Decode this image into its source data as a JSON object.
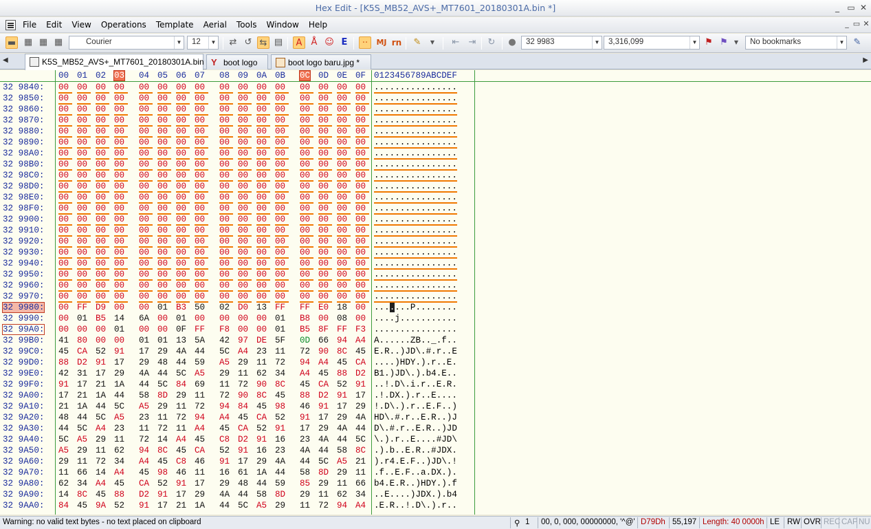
{
  "window": {
    "title": "Hex Edit - [K5S_MB52_AVS+_MT7601_20180301A.bin *]",
    "controls": [
      "_",
      "▭",
      "✕"
    ],
    "mdi_controls": [
      "_",
      "▭",
      "✕"
    ]
  },
  "menu": [
    "File",
    "Edit",
    "View",
    "Operations",
    "Template",
    "Aerial",
    "Tools",
    "Window",
    "Help"
  ],
  "toolbar": {
    "font_name": "Courier",
    "font_size": "12",
    "mj_label": "MJ",
    "rn_label": "rn",
    "e_label": "E",
    "address_combo": "32 9983",
    "value_combo": "3,316,099",
    "bookmarks_combo": "No bookmarks"
  },
  "tabs": [
    {
      "label": "K5S_MB52_AVS+_MT7601_20180301A.bin *",
      "icon": "file-icon",
      "active": true
    },
    {
      "label": "boot logo",
      "icon": "compare-icon",
      "active": false
    },
    {
      "label": "boot logo baru.jpg *",
      "icon": "image-file-icon",
      "active": false
    }
  ],
  "hex": {
    "columns": [
      "00",
      "01",
      "02",
      "03",
      "04",
      "05",
      "06",
      "07",
      "08",
      "09",
      "0A",
      "0B",
      "0C",
      "0D",
      "0E",
      "0F"
    ],
    "char_header": "0123456789ABCDEF",
    "highlight_columns": [
      "03",
      "0C"
    ],
    "rows": [
      {
        "addr": "32 9840:",
        "bytes": [
          "00",
          "00",
          "00",
          "00",
          "00",
          "00",
          "00",
          "00",
          "00",
          "00",
          "00",
          "00",
          "00",
          "00",
          "00",
          "00"
        ],
        "chars": "................"
      },
      {
        "addr": "32 9850:",
        "bytes": [
          "00",
          "00",
          "00",
          "00",
          "00",
          "00",
          "00",
          "00",
          "00",
          "00",
          "00",
          "00",
          "00",
          "00",
          "00",
          "00"
        ],
        "chars": "................"
      },
      {
        "addr": "32 9860:",
        "bytes": [
          "00",
          "00",
          "00",
          "00",
          "00",
          "00",
          "00",
          "00",
          "00",
          "00",
          "00",
          "00",
          "00",
          "00",
          "00",
          "00"
        ],
        "chars": "................"
      },
      {
        "addr": "32 9870:",
        "bytes": [
          "00",
          "00",
          "00",
          "00",
          "00",
          "00",
          "00",
          "00",
          "00",
          "00",
          "00",
          "00",
          "00",
          "00",
          "00",
          "00"
        ],
        "chars": "................"
      },
      {
        "addr": "32 9880:",
        "bytes": [
          "00",
          "00",
          "00",
          "00",
          "00",
          "00",
          "00",
          "00",
          "00",
          "00",
          "00",
          "00",
          "00",
          "00",
          "00",
          "00"
        ],
        "chars": "................"
      },
      {
        "addr": "32 9890:",
        "bytes": [
          "00",
          "00",
          "00",
          "00",
          "00",
          "00",
          "00",
          "00",
          "00",
          "00",
          "00",
          "00",
          "00",
          "00",
          "00",
          "00"
        ],
        "chars": "................"
      },
      {
        "addr": "32 98A0:",
        "bytes": [
          "00",
          "00",
          "00",
          "00",
          "00",
          "00",
          "00",
          "00",
          "00",
          "00",
          "00",
          "00",
          "00",
          "00",
          "00",
          "00"
        ],
        "chars": "................"
      },
      {
        "addr": "32 98B0:",
        "bytes": [
          "00",
          "00",
          "00",
          "00",
          "00",
          "00",
          "00",
          "00",
          "00",
          "00",
          "00",
          "00",
          "00",
          "00",
          "00",
          "00"
        ],
        "chars": "................"
      },
      {
        "addr": "32 98C0:",
        "bytes": [
          "00",
          "00",
          "00",
          "00",
          "00",
          "00",
          "00",
          "00",
          "00",
          "00",
          "00",
          "00",
          "00",
          "00",
          "00",
          "00"
        ],
        "chars": "................"
      },
      {
        "addr": "32 98D0:",
        "bytes": [
          "00",
          "00",
          "00",
          "00",
          "00",
          "00",
          "00",
          "00",
          "00",
          "00",
          "00",
          "00",
          "00",
          "00",
          "00",
          "00"
        ],
        "chars": "................"
      },
      {
        "addr": "32 98E0:",
        "bytes": [
          "00",
          "00",
          "00",
          "00",
          "00",
          "00",
          "00",
          "00",
          "00",
          "00",
          "00",
          "00",
          "00",
          "00",
          "00",
          "00"
        ],
        "chars": "................"
      },
      {
        "addr": "32 98F0:",
        "bytes": [
          "00",
          "00",
          "00",
          "00",
          "00",
          "00",
          "00",
          "00",
          "00",
          "00",
          "00",
          "00",
          "00",
          "00",
          "00",
          "00"
        ],
        "chars": "................"
      },
      {
        "addr": "32 9900:",
        "bytes": [
          "00",
          "00",
          "00",
          "00",
          "00",
          "00",
          "00",
          "00",
          "00",
          "00",
          "00",
          "00",
          "00",
          "00",
          "00",
          "00"
        ],
        "chars": "................"
      },
      {
        "addr": "32 9910:",
        "bytes": [
          "00",
          "00",
          "00",
          "00",
          "00",
          "00",
          "00",
          "00",
          "00",
          "00",
          "00",
          "00",
          "00",
          "00",
          "00",
          "00"
        ],
        "chars": "................"
      },
      {
        "addr": "32 9920:",
        "bytes": [
          "00",
          "00",
          "00",
          "00",
          "00",
          "00",
          "00",
          "00",
          "00",
          "00",
          "00",
          "00",
          "00",
          "00",
          "00",
          "00"
        ],
        "chars": "................"
      },
      {
        "addr": "32 9930:",
        "bytes": [
          "00",
          "00",
          "00",
          "00",
          "00",
          "00",
          "00",
          "00",
          "00",
          "00",
          "00",
          "00",
          "00",
          "00",
          "00",
          "00"
        ],
        "chars": "................"
      },
      {
        "addr": "32 9940:",
        "bytes": [
          "00",
          "00",
          "00",
          "00",
          "00",
          "00",
          "00",
          "00",
          "00",
          "00",
          "00",
          "00",
          "00",
          "00",
          "00",
          "00"
        ],
        "chars": "................"
      },
      {
        "addr": "32 9950:",
        "bytes": [
          "00",
          "00",
          "00",
          "00",
          "00",
          "00",
          "00",
          "00",
          "00",
          "00",
          "00",
          "00",
          "00",
          "00",
          "00",
          "00"
        ],
        "chars": "................"
      },
      {
        "addr": "32 9960:",
        "bytes": [
          "00",
          "00",
          "00",
          "00",
          "00",
          "00",
          "00",
          "00",
          "00",
          "00",
          "00",
          "00",
          "00",
          "00",
          "00",
          "00"
        ],
        "chars": "................"
      },
      {
        "addr": "32 9970:",
        "bytes": [
          "00",
          "00",
          "00",
          "00",
          "00",
          "00",
          "00",
          "00",
          "00",
          "00",
          "00",
          "00",
          "00",
          "00",
          "00",
          "00"
        ],
        "chars": "................"
      },
      {
        "addr": "32 9980:",
        "bytes": [
          "00",
          "FF",
          "D9",
          "00",
          "00",
          "01",
          "B3",
          "50",
          "02",
          "D0",
          "13",
          "FF",
          "FF",
          "E0",
          "18",
          "00"
        ],
        "chars": "...■...P........",
        "hl": true
      },
      {
        "addr": "32 9990:",
        "bytes": [
          "00",
          "01",
          "B5",
          "14",
          "6A",
          "00",
          "01",
          "00",
          "00",
          "00",
          "00",
          "01",
          "B8",
          "00",
          "08",
          "00"
        ],
        "chars": "....j..........."
      },
      {
        "addr": "32 99A0:",
        "bytes": [
          "00",
          "00",
          "00",
          "01",
          "00",
          "00",
          "0F",
          "FF",
          "F8",
          "00",
          "00",
          "01",
          "B5",
          "8F",
          "FF",
          "F3"
        ],
        "chars": "................",
        "box": true
      },
      {
        "addr": "32 99B0:",
        "bytes": [
          "41",
          "80",
          "00",
          "00",
          "01",
          "01",
          "13",
          "5A",
          "42",
          "97",
          "DE",
          "5F",
          "0D",
          "66",
          "94",
          "A4"
        ],
        "chars": "A......ZB.._.f.."
      },
      {
        "addr": "32 99C0:",
        "bytes": [
          "45",
          "CA",
          "52",
          "91",
          "17",
          "29",
          "4A",
          "44",
          "5C",
          "A4",
          "23",
          "11",
          "72",
          "90",
          "8C",
          "45"
        ],
        "chars": "E.R..)JD\\.#.r..E"
      },
      {
        "addr": "32 99D0:",
        "bytes": [
          "88",
          "D2",
          "91",
          "17",
          "29",
          "48",
          "44",
          "59",
          "A5",
          "29",
          "11",
          "72",
          "94",
          "A4",
          "45",
          "CA"
        ],
        "chars": "....)HDY.).r..E."
      },
      {
        "addr": "32 99E0:",
        "bytes": [
          "42",
          "31",
          "17",
          "29",
          "4A",
          "44",
          "5C",
          "A5",
          "29",
          "11",
          "62",
          "34",
          "A4",
          "45",
          "88",
          "D2"
        ],
        "chars": "B1.)JD\\.).b4.E.."
      },
      {
        "addr": "32 99F0:",
        "bytes": [
          "91",
          "17",
          "21",
          "1A",
          "44",
          "5C",
          "84",
          "69",
          "11",
          "72",
          "90",
          "8C",
          "45",
          "CA",
          "52",
          "91"
        ],
        "chars": "..!.D\\.i.r..E.R."
      },
      {
        "addr": "32 9A00:",
        "bytes": [
          "17",
          "21",
          "1A",
          "44",
          "58",
          "8D",
          "29",
          "11",
          "72",
          "90",
          "8C",
          "45",
          "88",
          "D2",
          "91",
          "17"
        ],
        "chars": ".!.DX.).r..E...."
      },
      {
        "addr": "32 9A10:",
        "bytes": [
          "21",
          "1A",
          "44",
          "5C",
          "A5",
          "29",
          "11",
          "72",
          "94",
          "84",
          "45",
          "98",
          "46",
          "91",
          "17",
          "29"
        ],
        "chars": "!.D\\.).r..E.F..)"
      },
      {
        "addr": "32 9A20:",
        "bytes": [
          "48",
          "44",
          "5C",
          "A5",
          "23",
          "11",
          "72",
          "94",
          "A4",
          "45",
          "CA",
          "52",
          "91",
          "17",
          "29",
          "4A"
        ],
        "chars": "HD\\.#.r..E.R..)J"
      },
      {
        "addr": "32 9A30:",
        "bytes": [
          "44",
          "5C",
          "A4",
          "23",
          "11",
          "72",
          "11",
          "A4",
          "45",
          "CA",
          "52",
          "91",
          "17",
          "29",
          "4A",
          "44"
        ],
        "chars": "D\\.#.r..E.R..)JD"
      },
      {
        "addr": "32 9A40:",
        "bytes": [
          "5C",
          "A5",
          "29",
          "11",
          "72",
          "14",
          "A4",
          "45",
          "C8",
          "D2",
          "91",
          "16",
          "23",
          "4A",
          "44",
          "5C"
        ],
        "chars": "\\.).r..E....#JD\\"
      },
      {
        "addr": "32 9A50:",
        "bytes": [
          "A5",
          "29",
          "11",
          "62",
          "94",
          "8C",
          "45",
          "CA",
          "52",
          "91",
          "16",
          "23",
          "4A",
          "44",
          "58",
          "8C"
        ],
        "chars": ".).b..E.R..#JDX."
      },
      {
        "addr": "32 9A60:",
        "bytes": [
          "29",
          "11",
          "72",
          "34",
          "A4",
          "45",
          "C8",
          "46",
          "91",
          "17",
          "29",
          "4A",
          "44",
          "5C",
          "A5",
          "21"
        ],
        "chars": ").r4.E.F..)JD\\.!"
      },
      {
        "addr": "32 9A70:",
        "bytes": [
          "11",
          "66",
          "14",
          "A4",
          "45",
          "98",
          "46",
          "11",
          "16",
          "61",
          "1A",
          "44",
          "58",
          "8D",
          "29",
          "11"
        ],
        "chars": ".f..E.F..a.DX.)."
      },
      {
        "addr": "32 9A80:",
        "bytes": [
          "62",
          "34",
          "A4",
          "45",
          "CA",
          "52",
          "91",
          "17",
          "29",
          "48",
          "44",
          "59",
          "85",
          "29",
          "11",
          "66"
        ],
        "chars": "b4.E.R..)HDY.).f"
      },
      {
        "addr": "32 9A90:",
        "bytes": [
          "14",
          "8C",
          "45",
          "88",
          "D2",
          "91",
          "17",
          "29",
          "4A",
          "44",
          "58",
          "8D",
          "29",
          "11",
          "62",
          "34"
        ],
        "chars": "..E....)JDX.).b4"
      },
      {
        "addr": "32 9AA0:",
        "bytes": [
          "84",
          "45",
          "9A",
          "52",
          "91",
          "17",
          "21",
          "1A",
          "44",
          "5C",
          "A5",
          "29",
          "11",
          "72",
          "94",
          "A4"
        ],
        "chars": ".E.R..!.D\\.).r.."
      }
    ]
  },
  "status": {
    "message": "Warning: no valid text bytes - no text placed on clipboard",
    "sel_count": "1",
    "clip_info": "00, 0, 000, 00000000, '^@'",
    "hex_addr": "D79Dh",
    "dec_addr": "55,197",
    "length": "Length: 40 0000h",
    "endian": "LE",
    "rw": "RW",
    "ovr": "OVR",
    "rec": "REC",
    "cap": "CAP",
    "num": "NU"
  },
  "colors": {
    "accent": "#f07800",
    "header": "#1a2c9c",
    "nonzero": "#d0001a"
  }
}
